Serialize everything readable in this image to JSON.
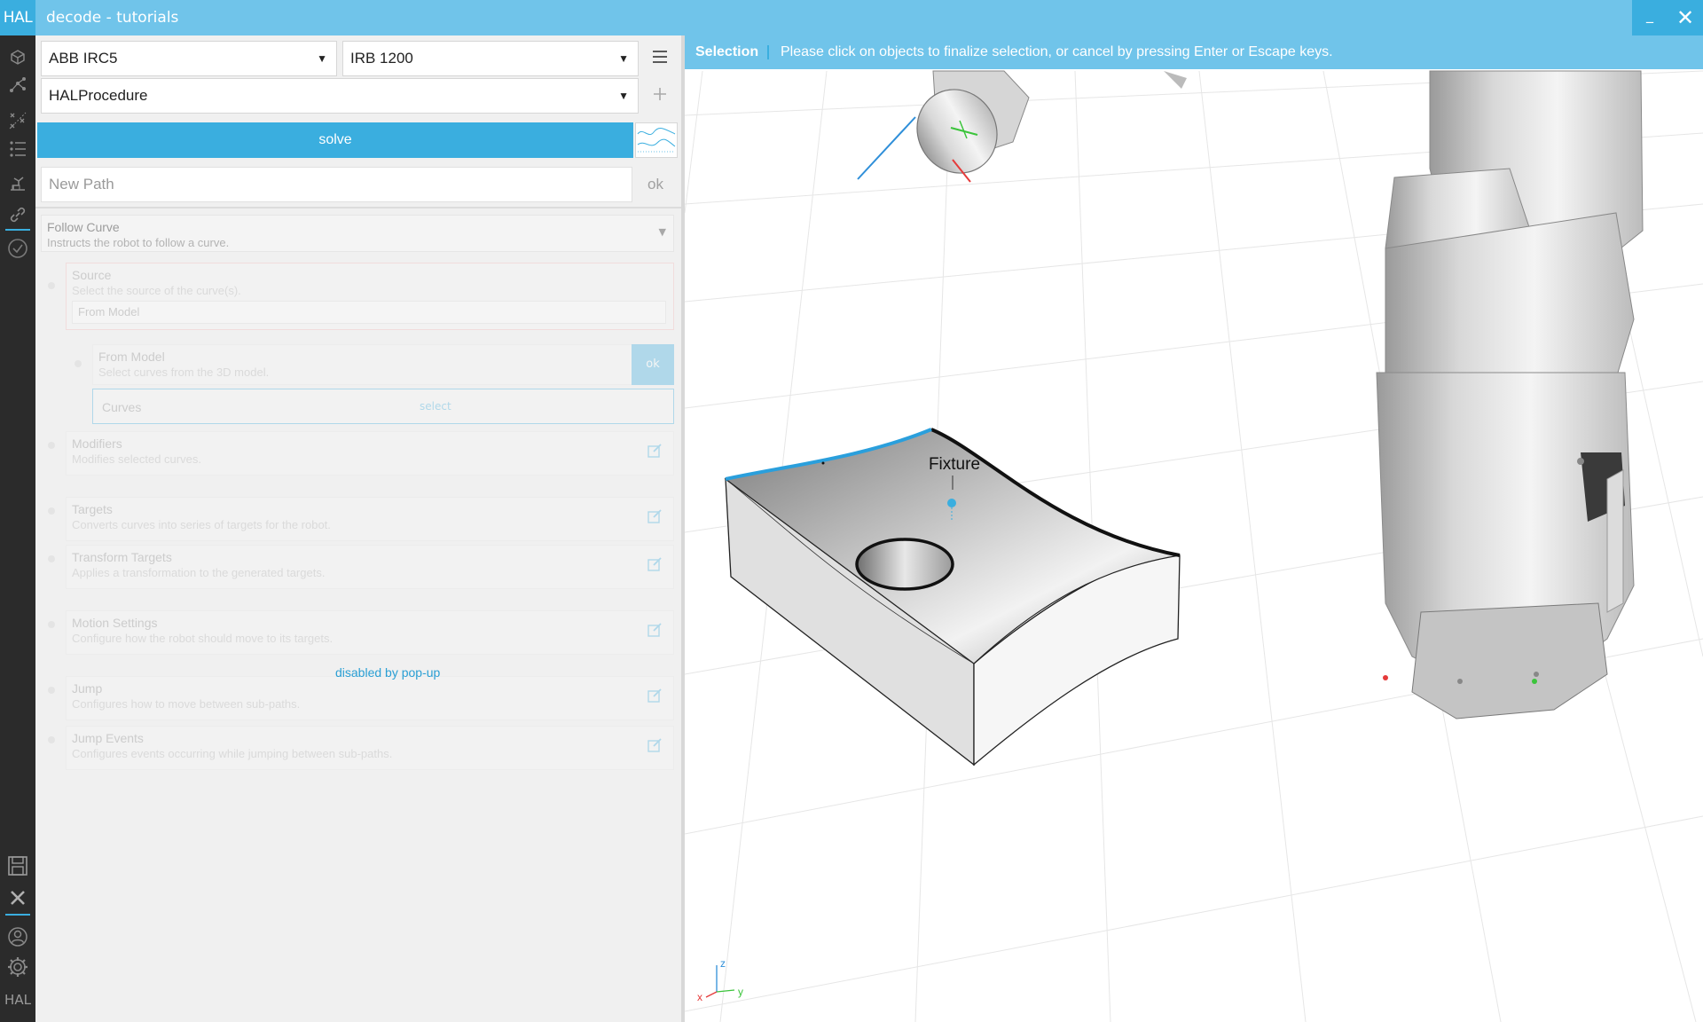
{
  "window": {
    "logo": "HAL",
    "title": "decode - tutorials",
    "minimize": "_",
    "close": "✕"
  },
  "controller": {
    "value": "ABB IRC5"
  },
  "robot": {
    "value": "IRB 1200"
  },
  "procedure": {
    "value": "HALProcedure"
  },
  "solve_label": "solve",
  "new_path": {
    "placeholder": "New Path",
    "ok_label": "ok"
  },
  "follow_curve": {
    "title": "Follow Curve",
    "description": "Instructs the robot to follow a curve."
  },
  "sections": {
    "source": {
      "title": "Source",
      "description": "Select the source of the curve(s).",
      "value": "From Model"
    },
    "from_model": {
      "title": "From Model",
      "description": "Select curves from the 3D model.",
      "curves_label": "Curves",
      "select_label": "select",
      "ok_label": "ok"
    },
    "modifiers": {
      "title": "Modifiers",
      "description": "Modifies selected curves."
    },
    "targets": {
      "title": "Targets",
      "description": "Converts curves into series of targets for the robot."
    },
    "transform_targets": {
      "title": "Transform Targets",
      "description": "Applies a transformation to the generated targets."
    },
    "motion_settings": {
      "title": "Motion Settings",
      "description": "Configure how the robot should move to its targets."
    },
    "jump": {
      "title": "Jump",
      "description": "Configures how to move between sub-paths."
    },
    "jump_events": {
      "title": "Jump Events",
      "description": "Configures events occurring while jumping between sub-paths."
    }
  },
  "disabled_message": "disabled by pop-up",
  "selection_bar": {
    "label": "Selection",
    "message": "Please click on objects to finalize selection, or cancel by pressing Enter or Escape keys."
  },
  "scene": {
    "fixture_label": "Fixture",
    "axis_x": "x",
    "axis_y": "y",
    "axis_z": "z"
  },
  "rail": {
    "bottom_logo": "HAL"
  },
  "colors": {
    "accent": "#3aaedf",
    "titlebar": "#70c4ea",
    "rail": "#2b2b2b",
    "panel": "#f0f0f0"
  },
  "icons": [
    "cube-icon",
    "graph-icon",
    "scatter-icon",
    "list-icon",
    "robot-icon",
    "link-icon",
    "check-icon",
    "save-icon",
    "close-icon",
    "user-icon",
    "gear-icon",
    "menu-icon",
    "plus-icon",
    "edit-icon"
  ]
}
